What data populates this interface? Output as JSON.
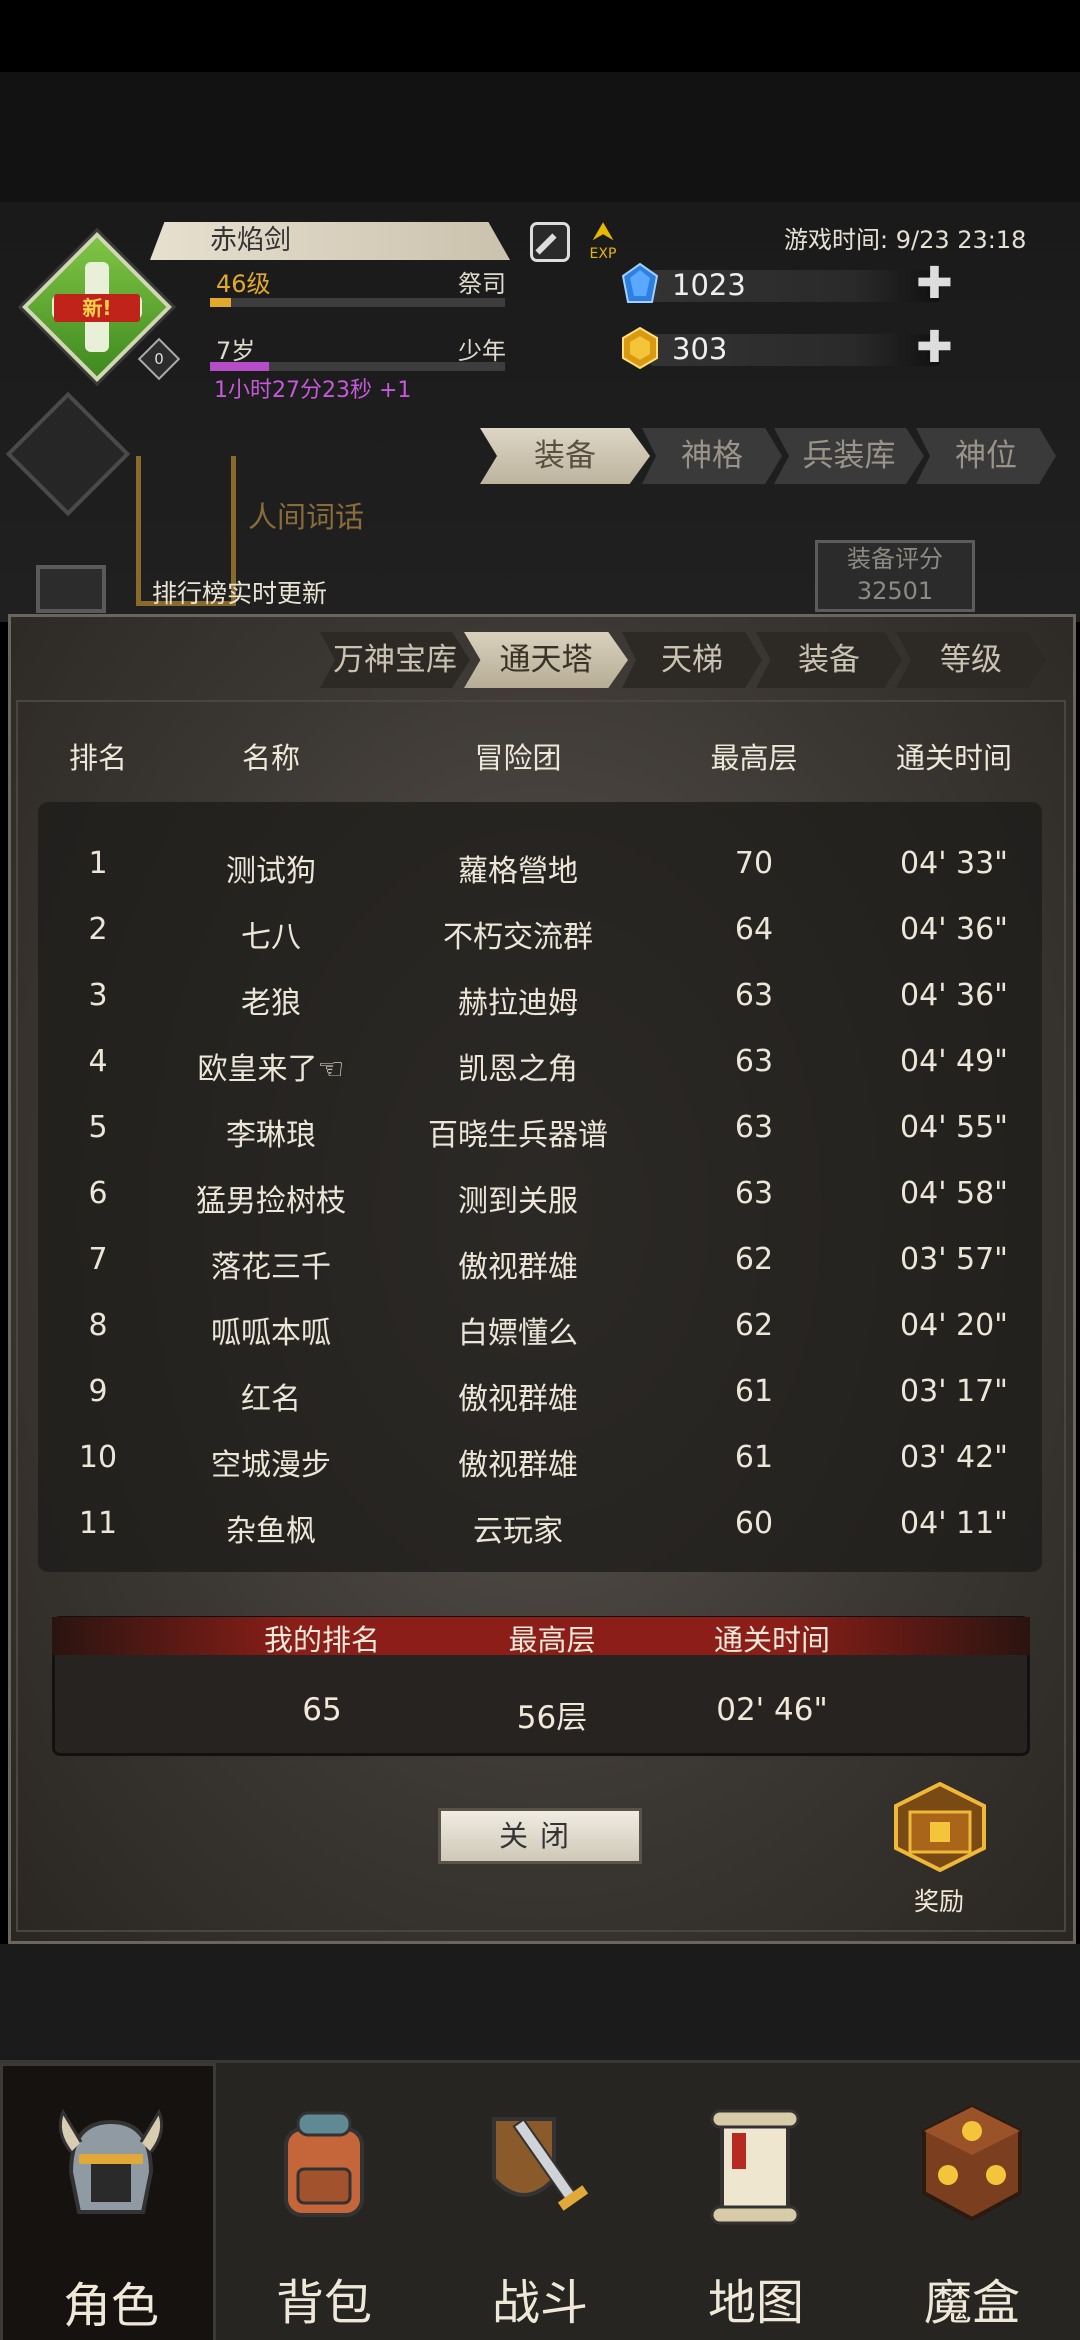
{
  "player": {
    "name": "赤焰剑",
    "new_tag": "新!",
    "badge_count": "0",
    "level": "46级",
    "class": "祭司",
    "level_progress": 0.07,
    "age": "7岁",
    "age_title": "少年",
    "age_progress": 0.2,
    "timer": "1小时27分23秒 +1"
  },
  "header": {
    "exp_label": "EXP",
    "game_time": "游戏时间: 9/23 23:18",
    "gems": "1023",
    "gold": "303",
    "plus": "✚"
  },
  "top_tabs": [
    "装备",
    "神格",
    "兵装库",
    "神位"
  ],
  "side": {
    "book_title": "人间词话",
    "rank_note": "排行榜实时更新",
    "score_label": "装备评分",
    "score_value": "32501"
  },
  "leaderboard": {
    "tabs": [
      "万神宝库",
      "通天塔",
      "天梯",
      "装备",
      "等级"
    ],
    "columns": [
      "排名",
      "名称",
      "冒险团",
      "最高层",
      "通关时间"
    ],
    "rows": [
      {
        "rank": "1",
        "name": "测试狗",
        "team": "蘿格營地",
        "floor": "70",
        "time": "04' 33\""
      },
      {
        "rank": "2",
        "name": "七八",
        "team": "不朽交流群",
        "floor": "64",
        "time": "04' 36\""
      },
      {
        "rank": "3",
        "name": "老狼",
        "team": "赫拉迪姆",
        "floor": "63",
        "time": "04' 36\""
      },
      {
        "rank": "4",
        "name": "欧皇来了☜",
        "team": "凯恩之角",
        "floor": "63",
        "time": "04' 49\""
      },
      {
        "rank": "5",
        "name": "李琳琅",
        "team": "百晓生兵器谱",
        "floor": "63",
        "time": "04' 55\""
      },
      {
        "rank": "6",
        "name": "猛男捡树枝",
        "team": "测到关服",
        "floor": "63",
        "time": "04' 58\""
      },
      {
        "rank": "7",
        "name": "落花三千",
        "team": "傲视群雄",
        "floor": "62",
        "time": "03' 57\""
      },
      {
        "rank": "8",
        "name": "呱呱本呱",
        "team": "白嫖懂么",
        "floor": "62",
        "time": "04' 20\""
      },
      {
        "rank": "9",
        "name": "红名",
        "team": "傲视群雄",
        "floor": "61",
        "time": "03' 17\""
      },
      {
        "rank": "10",
        "name": "空城漫步",
        "team": "傲视群雄",
        "floor": "61",
        "time": "03' 42\""
      },
      {
        "rank": "11",
        "name": "杂鱼枫",
        "team": "云玩家",
        "floor": "60",
        "time": "04' 11\""
      }
    ],
    "mine": {
      "headers": [
        "我的排名",
        "最高层",
        "通关时间"
      ],
      "rank": "65",
      "floor": "56层",
      "time": "02' 46\""
    },
    "close_label": "关闭",
    "reward_label": "奖励"
  },
  "nav": [
    "角色",
    "背包",
    "战斗",
    "地图",
    "魔盒"
  ],
  "colors": {
    "accent_gold": "#e3a92a",
    "timer_purple": "#c45ad8",
    "my_rank_red": "#8b1e18"
  }
}
